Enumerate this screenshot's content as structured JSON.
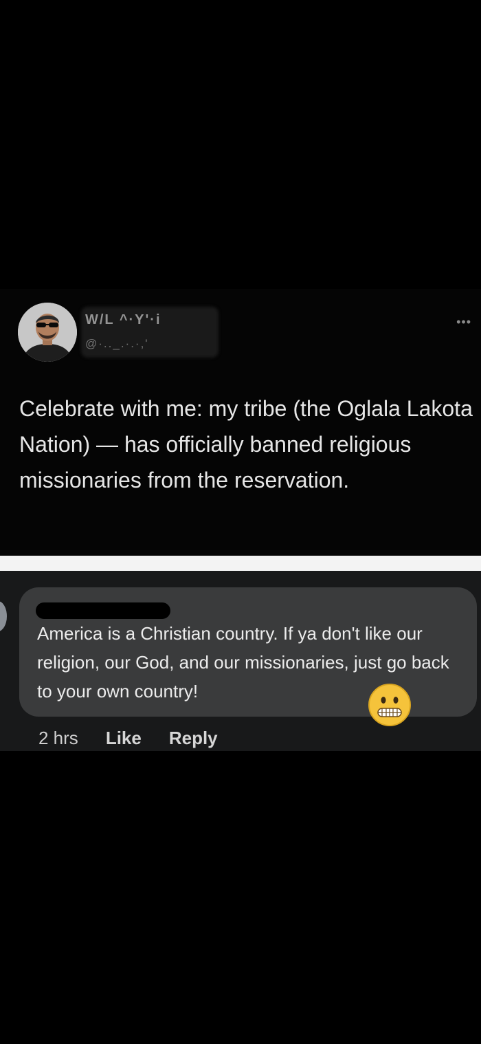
{
  "tweet": {
    "display_name": "W/L ^·Y'·i",
    "handle": "@·.._.·.·,'",
    "more_label": "•••",
    "text": "Celebrate with me: my tribe (the Oglala Lakota Nation) — has officially banned religious missionaries from the reservation."
  },
  "comment": {
    "commenter_name": "",
    "text": "America is a Christian country. If ya don't like our religion, our God, and our missionaries, just go back to your own country!",
    "emoji_icon": "grimacing-face-icon",
    "time": "2 hrs",
    "like_label": "Like",
    "reply_label": "Reply"
  },
  "colors": {
    "background": "#000000",
    "tweet_text": "#e6e6e6",
    "comment_bg": "#18191a",
    "bubble_bg": "#3a3b3c",
    "divider": "#f3f3f3"
  }
}
